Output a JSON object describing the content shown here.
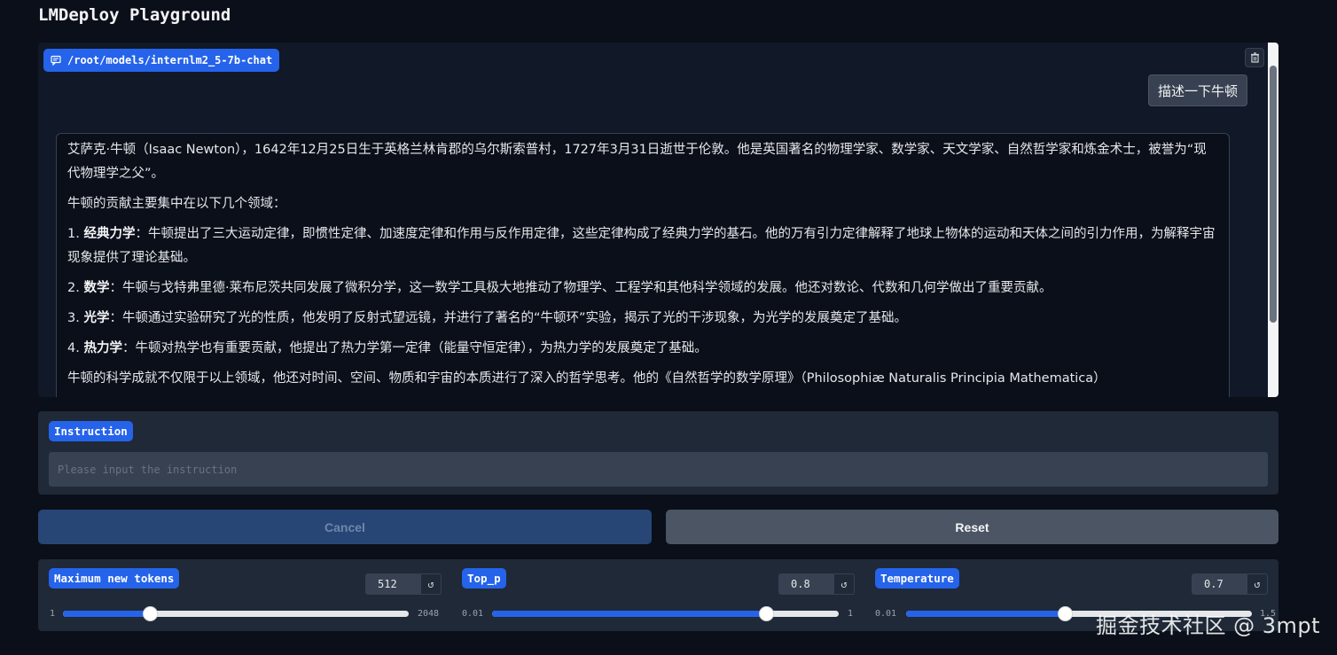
{
  "app": {
    "title": "LMDeploy Playground"
  },
  "chat": {
    "model_label": "/root/models/internlm2_5-7b-chat",
    "user_message": "描述一下牛顿",
    "bot": {
      "intro": "艾萨克·牛顿（Isaac Newton），1642年12月25日生于英格兰林肯郡的乌尔斯索普村，1727年3月31日逝世于伦敦。他是英国著名的物理学家、数学家、天文学家、自然哲学家和炼金术士，被誉为“现代物理学之父”。",
      "lead": "牛顿的贡献主要集中在以下几个领域：",
      "items": [
        {
          "num": "1.",
          "title": "经典力学",
          "text": "：牛顿提出了三大运动定律，即惯性定律、加速度定律和作用与反作用定律，这些定律构成了经典力学的基石。他的万有引力定律解释了地球上物体的运动和天体之间的引力作用，为解释宇宙现象提供了理论基础。"
        },
        {
          "num": "2.",
          "title": "数学",
          "text": "：牛顿与戈特弗里德·莱布尼茨共同发展了微积分学，这一数学工具极大地推动了物理学、工程学和其他科学领域的发展。他还对数论、代数和几何学做出了重要贡献。"
        },
        {
          "num": "3.",
          "title": "光学",
          "text": "：牛顿通过实验研究了光的性质，他发明了反射式望远镜，并进行了著名的“牛顿环”实验，揭示了光的干涉现象，为光学的发展奠定了基础。"
        },
        {
          "num": "4.",
          "title": "热力学",
          "text": "：牛顿对热学也有重要贡献，他提出了热力学第一定律（能量守恒定律），为热力学的发展奠定了基础。"
        }
      ],
      "outro": "牛顿的科学成就不仅限于以上领域，他还对时间、空间、物质和宇宙的本质进行了深入的哲学思考。他的《自然哲学的数学原理》（Philosophiæ Naturalis Principia Mathematica）"
    }
  },
  "instruction": {
    "label": "Instruction",
    "placeholder": "Please input the instruction"
  },
  "buttons": {
    "cancel": "Cancel",
    "reset": "Reset"
  },
  "sliders": [
    {
      "label": "Maximum new tokens",
      "value": "512",
      "min": "1",
      "max": "2048",
      "fraction": 0.25
    },
    {
      "label": "Top_p",
      "value": "0.8",
      "min": "0.01",
      "max": "1",
      "fraction": 0.79
    },
    {
      "label": "Temperature",
      "value": "0.7",
      "min": "0.01",
      "max": "1.5",
      "fraction": 0.46
    }
  ],
  "watermark": "掘金技术社区 @ 3mpt",
  "colors": {
    "accent": "#2563eb",
    "background": "#0b0f19",
    "panel": "#1f2937"
  },
  "icons": {
    "badge": "chat-bubble-icon",
    "clear": "trash-icon",
    "reset": "reset-icon"
  }
}
